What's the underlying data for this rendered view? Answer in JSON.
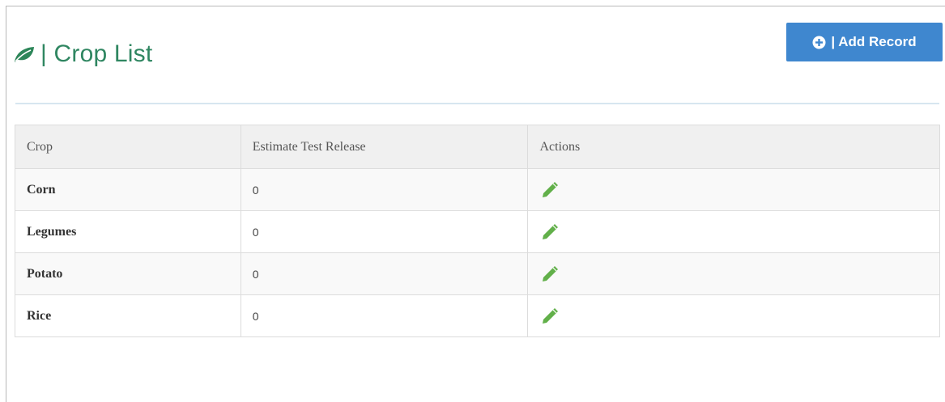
{
  "page": {
    "title_separator": "|",
    "title": "Crop List",
    "title_icon": "leaf-icon",
    "title_color": "#2f8661"
  },
  "toolbar": {
    "add_icon": "plus-circle-icon",
    "add_label": "| Add Record",
    "add_color": "#3f87cf"
  },
  "table": {
    "columns": [
      "Crop",
      "Estimate Test Release",
      "Actions"
    ],
    "rows": [
      {
        "crop": "Corn",
        "estimate": "0",
        "action_icon": "pencil-icon"
      },
      {
        "crop": "Legumes",
        "estimate": "0",
        "action_icon": "pencil-icon"
      },
      {
        "crop": "Potato",
        "estimate": "0",
        "action_icon": "pencil-icon"
      },
      {
        "crop": "Rice",
        "estimate": "0",
        "action_icon": "pencil-icon"
      }
    ],
    "edit_icon_color": "#62b04a"
  }
}
